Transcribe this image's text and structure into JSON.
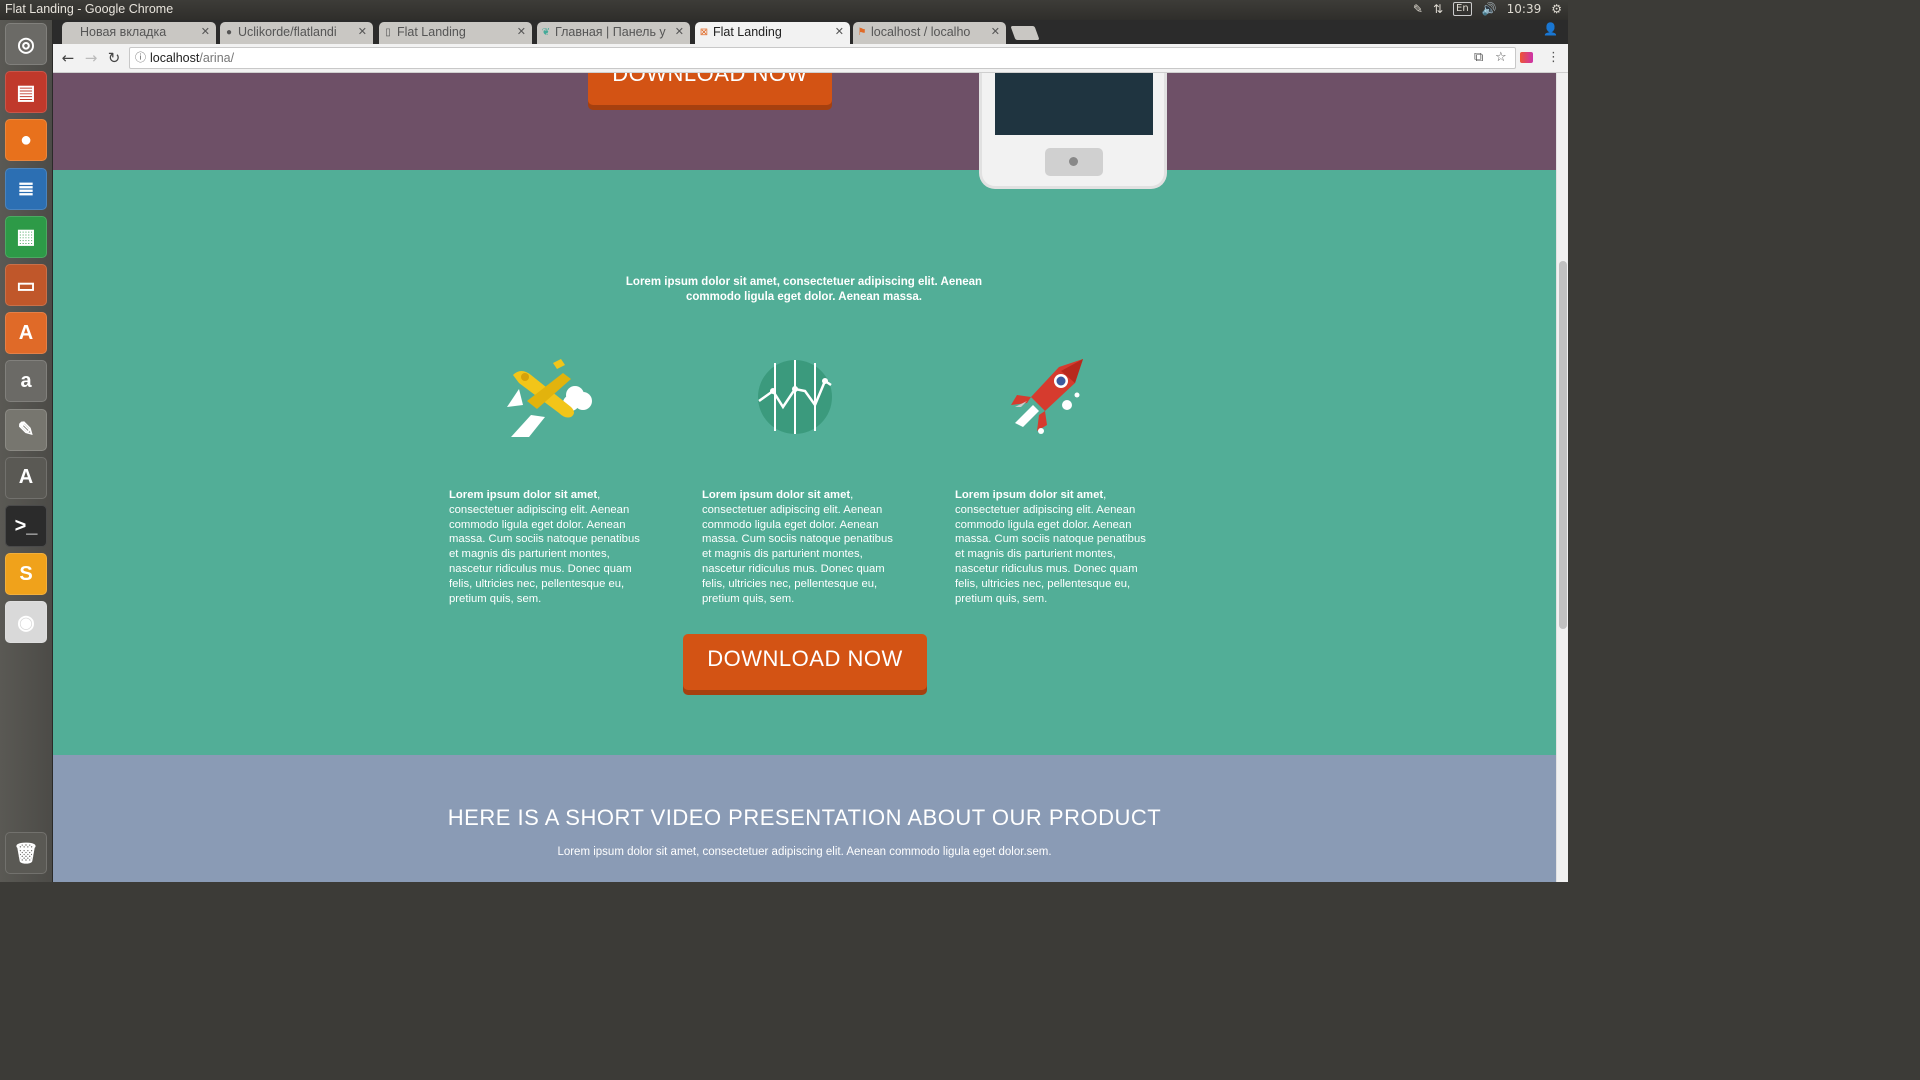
{
  "os": {
    "window_title": "Flat Landing - Google Chrome",
    "keyboard_layout": "En",
    "clock": "10:39"
  },
  "launcher": {
    "items": [
      {
        "name": "ubuntu-dash",
        "glyph": "◎",
        "color": "#6b6a66"
      },
      {
        "name": "files",
        "glyph": "▤",
        "color": "#c0392b"
      },
      {
        "name": "firefox",
        "glyph": "●",
        "color": "#e8711c"
      },
      {
        "name": "libreoffice-writer",
        "glyph": "≣",
        "color": "#2c6fb3"
      },
      {
        "name": "libreoffice-calc",
        "glyph": "▦",
        "color": "#2d9a47"
      },
      {
        "name": "libreoffice-impress",
        "glyph": "▭",
        "color": "#c0572a"
      },
      {
        "name": "software-center",
        "glyph": "A",
        "color": "#e06a28"
      },
      {
        "name": "amazon",
        "glyph": "a",
        "color": "#6b6a66"
      },
      {
        "name": "system-settings",
        "glyph": "✎",
        "color": "#77766f"
      },
      {
        "name": "software-updater",
        "glyph": "A",
        "color": "#5a5954"
      },
      {
        "name": "terminal",
        "glyph": ">_",
        "color": "#2b2b2b"
      },
      {
        "name": "sublime-text",
        "glyph": "S",
        "color": "#f0a21b"
      },
      {
        "name": "chrome",
        "glyph": "◉",
        "color": "#d9d9d9"
      },
      {
        "name": "trash",
        "glyph": "🗑",
        "color": "#5a5954"
      }
    ]
  },
  "browser": {
    "tabs": [
      {
        "label": "Новая вкладка",
        "icon": "",
        "active": false
      },
      {
        "label": "Uclikorde/flatlandi",
        "icon": "github-icon",
        "active": false
      },
      {
        "label": "Flat Landing",
        "icon": "page-icon",
        "active": false
      },
      {
        "label": "Главная | Панель у",
        "icon": "leaf-icon",
        "active": false
      },
      {
        "label": "Flat Landing",
        "icon": "html-icon",
        "active": true
      },
      {
        "label": "localhost / localho",
        "icon": "pma-icon",
        "active": false
      }
    ],
    "url_host": "localhost",
    "url_path": "/arina/"
  },
  "page": {
    "hero_button": "DOWNLOAD NOW",
    "intro": "Lorem ipsum dolor sit amet, consectetuer adipiscing elit. Aenean commodo ligula eget dolor. Aenean massa.",
    "features": [
      {
        "icon": "airplane-icon",
        "lead": "Lorem ipsum dolor sit amet",
        "body": ", consectetuer adipiscing elit. Aenean commodo ligula eget dolor. Aenean massa. Cum sociis natoque penatibus et magnis dis parturient montes, nascetur ridiculus mus. Donec quam felis, ultricies nec, pellentesque eu, pretium quis, sem."
      },
      {
        "icon": "chart-globe-icon",
        "lead": "Lorem ipsum dolor sit amet",
        "body": ", consectetuer adipiscing elit. Aenean commodo ligula eget dolor. Aenean massa. Cum sociis natoque penatibus et magnis dis parturient montes, nascetur ridiculus mus. Donec quam felis, ultricies nec, pellentesque eu, pretium quis, sem."
      },
      {
        "icon": "rocket-icon",
        "lead": "Lorem ipsum dolor sit amet",
        "body": ", consectetuer adipiscing elit. Aenean commodo ligula eget dolor. Aenean massa. Cum sociis natoque penatibus et magnis dis parturient montes, nascetur ridiculus mus. Donec quam felis, ultricies nec, pellentesque eu, pretium quis, sem."
      }
    ],
    "download_button": "DOWNLOAD NOW",
    "video_heading": "HERE IS A SHORT VIDEO PRESENTATION ABOUT OUR PRODUCT",
    "video_text": "Lorem ipsum dolor sit amet, consectetuer adipiscing elit. Aenean commodo ligula eget dolor.sem."
  },
  "colors": {
    "hero_bg": "#6e5067",
    "features_bg": "#52ae97",
    "button_bg": "#d35314",
    "video_bg": "#8a9bb5"
  }
}
